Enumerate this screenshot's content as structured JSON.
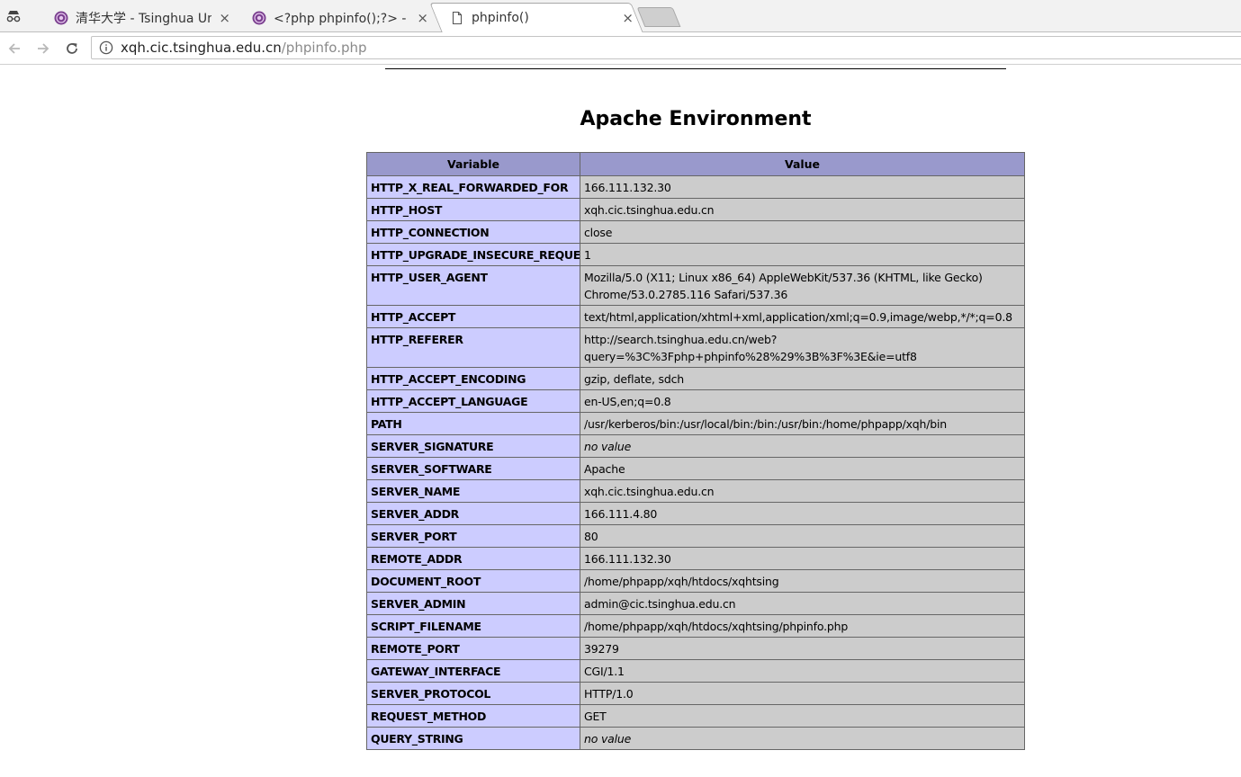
{
  "browser": {
    "tabs": [
      {
        "title": "清华大学 - Tsinghua Un",
        "favicon": "tsinghua-seal-icon"
      },
      {
        "title": "<?php phpinfo();?> - 百",
        "favicon": "tsinghua-seal-icon"
      },
      {
        "title": "phpinfo()",
        "favicon": "page-icon",
        "active": true
      }
    ],
    "close_glyph": "×",
    "url_host": "xqh.cic.tsinghua.edu.cn",
    "url_path": "/phpinfo.php"
  },
  "page": {
    "section_title": "Apache Environment",
    "table": {
      "headers": [
        "Variable",
        "Value"
      ],
      "rows": [
        {
          "name": "HTTP_X_REAL_FORWARDED_FOR",
          "value": "166.111.132.30"
        },
        {
          "name": "HTTP_HOST",
          "value": "xqh.cic.tsinghua.edu.cn"
        },
        {
          "name": "HTTP_CONNECTION",
          "value": "close"
        },
        {
          "name": "HTTP_UPGRADE_INSECURE_REQUESTS",
          "value": "1"
        },
        {
          "name": "HTTP_USER_AGENT",
          "value": "Mozilla/5.0 (X11; Linux x86_64) AppleWebKit/537.36 (KHTML, like Gecko) Chrome/53.0.2785.116 Safari/537.36"
        },
        {
          "name": "HTTP_ACCEPT",
          "value": "text/html,application/xhtml+xml,application/xml;q=0.9,image/webp,*/*;q=0.8"
        },
        {
          "name": "HTTP_REFERER",
          "value": "http://search.tsinghua.edu.cn/web?query=%3C%3Fphp+phpinfo%28%29%3B%3F%3E&ie=utf8"
        },
        {
          "name": "HTTP_ACCEPT_ENCODING",
          "value": "gzip, deflate, sdch"
        },
        {
          "name": "HTTP_ACCEPT_LANGUAGE",
          "value": "en-US,en;q=0.8"
        },
        {
          "name": "PATH",
          "value": "/usr/kerberos/bin:/usr/local/bin:/bin:/usr/bin:/home/phpapp/xqh/bin"
        },
        {
          "name": "SERVER_SIGNATURE",
          "value": "no value",
          "novalue": true
        },
        {
          "name": "SERVER_SOFTWARE",
          "value": "Apache"
        },
        {
          "name": "SERVER_NAME",
          "value": "xqh.cic.tsinghua.edu.cn"
        },
        {
          "name": "SERVER_ADDR",
          "value": "166.111.4.80"
        },
        {
          "name": "SERVER_PORT",
          "value": "80"
        },
        {
          "name": "REMOTE_ADDR",
          "value": "166.111.132.30"
        },
        {
          "name": "DOCUMENT_ROOT",
          "value": "/home/phpapp/xqh/htdocs/xqhtsing"
        },
        {
          "name": "SERVER_ADMIN",
          "value": "admin@cic.tsinghua.edu.cn"
        },
        {
          "name": "SCRIPT_FILENAME",
          "value": "/home/phpapp/xqh/htdocs/xqhtsing/phpinfo.php"
        },
        {
          "name": "REMOTE_PORT",
          "value": "39279"
        },
        {
          "name": "GATEWAY_INTERFACE",
          "value": "CGI/1.1"
        },
        {
          "name": "SERVER_PROTOCOL",
          "value": "HTTP/1.0"
        },
        {
          "name": "REQUEST_METHOD",
          "value": "GET"
        },
        {
          "name": "QUERY_STRING",
          "value": "no value",
          "novalue": true
        }
      ]
    }
  }
}
